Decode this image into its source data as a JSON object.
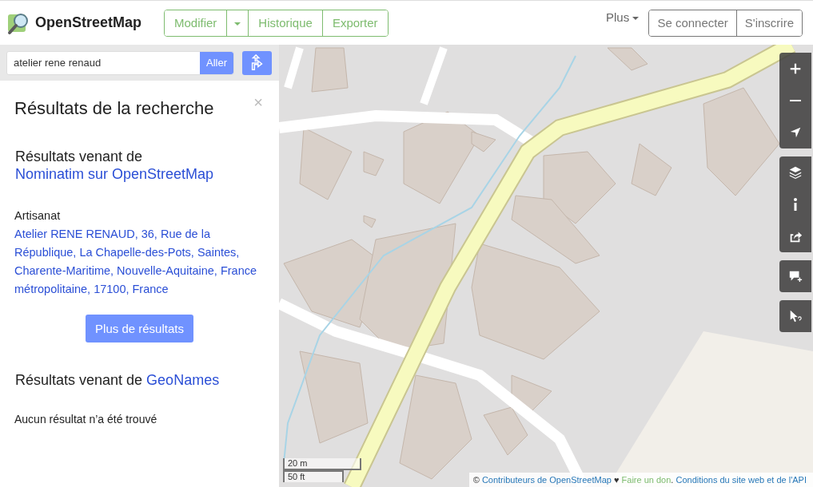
{
  "header": {
    "brand": "OpenStreetMap",
    "edit_group": [
      {
        "label": "Modifier",
        "kind": "button"
      },
      {
        "kind": "caret"
      },
      {
        "label": "Historique",
        "kind": "button"
      },
      {
        "label": "Exporter",
        "kind": "button"
      }
    ],
    "more": "Plus",
    "auth": [
      "Se connecter",
      "S'inscrire"
    ]
  },
  "search": {
    "value": "atelier rene renaud",
    "button": "Aller"
  },
  "results": {
    "title": "Résultats de la recherche",
    "close": "×",
    "sections": [
      {
        "prefix": "Résultats venant de ",
        "source": "Nominatim sur OpenStreetMap",
        "items": [
          {
            "type": "Artisanat",
            "link": "Atelier RENE RENAUD, 36, Rue de la République, La Chapelle-des-Pots, Saintes, Charente-Maritime, Nouvelle-Aquitaine, France métropolitaine, 17100, France"
          }
        ],
        "more": "Plus de résultats"
      },
      {
        "prefix": "Résultats venant de ",
        "source": "GeoNames",
        "empty": "Aucun résultat n’a été trouvé"
      }
    ]
  },
  "map_controls": [
    {
      "kind": "zoom-in"
    },
    {
      "kind": "zoom-out"
    },
    {
      "kind": "locate"
    },
    {
      "kind": "layers"
    },
    {
      "kind": "info"
    },
    {
      "kind": "share"
    },
    {
      "kind": "note"
    },
    {
      "kind": "query"
    }
  ],
  "scale": [
    "20 m",
    "50 ft"
  ],
  "attribution": {
    "prefix": "© ",
    "contributors": "Contributeurs de OpenStreetMap",
    "heart": "♥",
    "donate": "Faire un don",
    "sep": ". ",
    "terms": "Conditions du site web et de l'API"
  }
}
